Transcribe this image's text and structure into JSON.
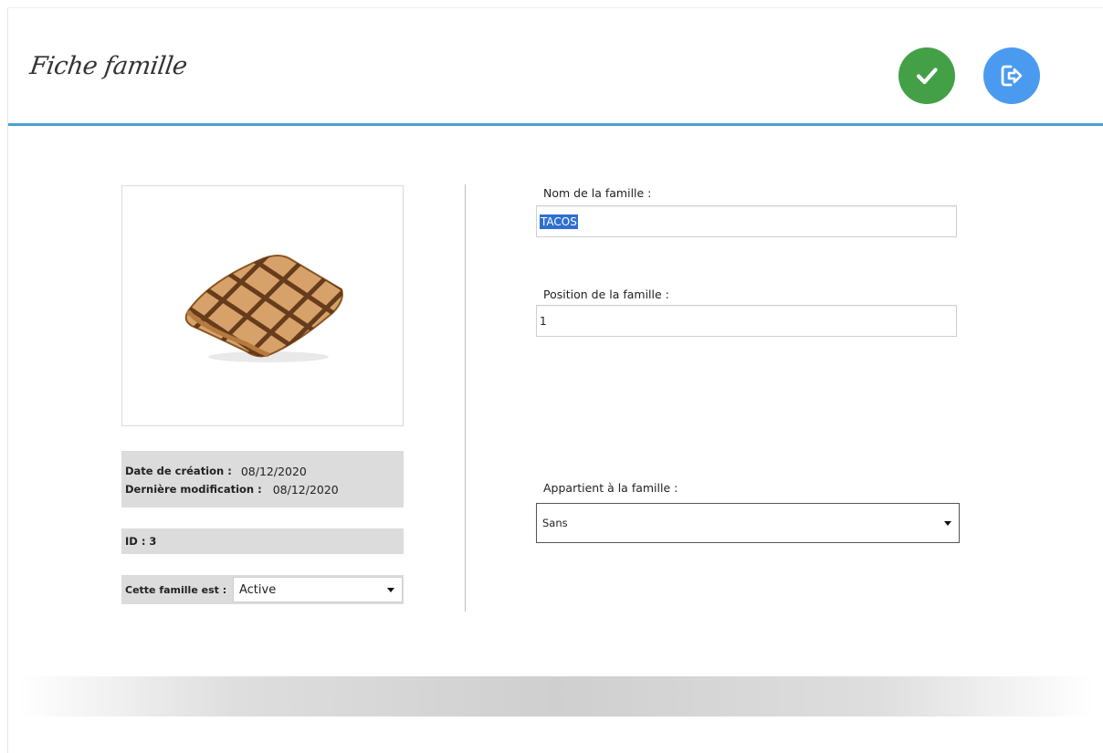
{
  "header": {
    "title": "Fiche famille",
    "validate_icon": "check-icon",
    "exit_icon": "exit-icon",
    "colors": {
      "validate": "#43a047",
      "exit": "#4a9bf0",
      "accent_line": "#4a9fd0"
    }
  },
  "photo": {
    "icon": "tacos-image"
  },
  "info": {
    "creation_label": "Date de création :",
    "creation_value": "08/12/2020",
    "modification_label": "Dernière modification :",
    "modification_value": "08/12/2020",
    "id_text": "ID : 3"
  },
  "state": {
    "label": "Cette famille est :",
    "value": "Active"
  },
  "form": {
    "name_label": "Nom de la famille :",
    "name_value": "TACOS",
    "position_label": "Position de la famille :",
    "position_value": "1",
    "parent_label": "Appartient à la famille :",
    "parent_value": "Sans"
  }
}
